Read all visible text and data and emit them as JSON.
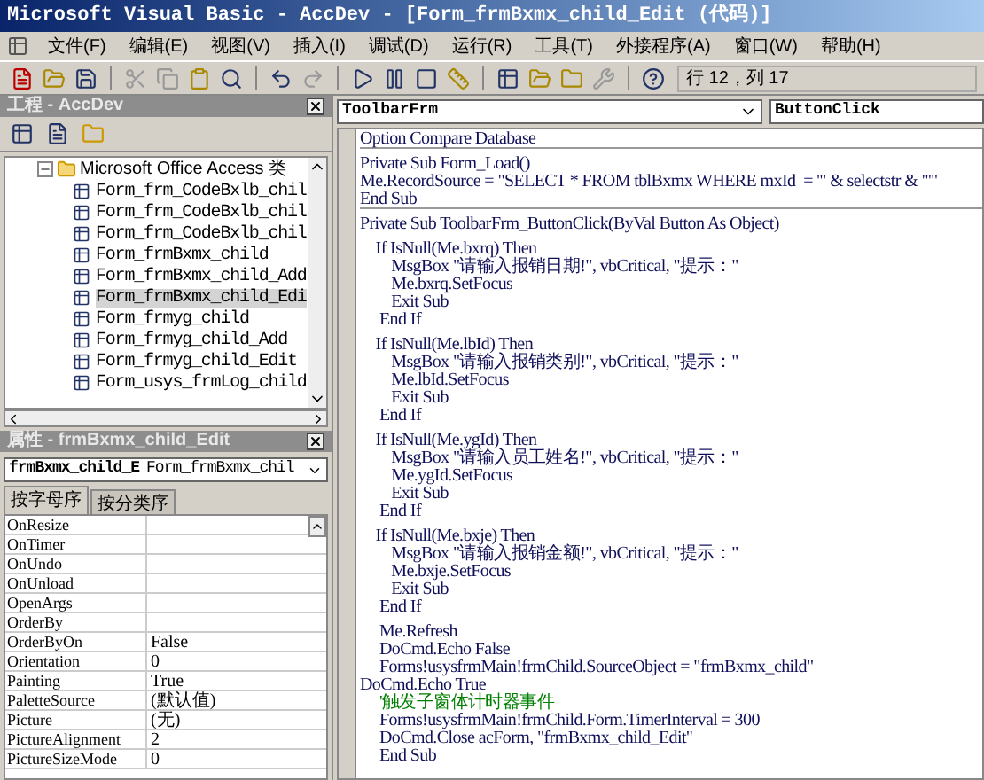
{
  "window": {
    "title": "Microsoft Visual Basic - AccDev - [Form_frmBxmx_child_Edit (代码)]"
  },
  "menu": [
    "文件(F)",
    "编辑(E)",
    "视图(V)",
    "插入(I)",
    "调试(D)",
    "运行(R)",
    "工具(T)",
    "外接程序(A)",
    "窗口(W)",
    "帮助(H)"
  ],
  "toolbar": {
    "position": "行 12，列 17"
  },
  "project": {
    "title": "工程 - AccDev",
    "tree": [
      {
        "label": "Microsoft Office Access 类",
        "expanded": true,
        "selected": false,
        "children": [
          {
            "label": "Form_frm_CodeBxlb_chil",
            "selected": false
          },
          {
            "label": "Form_frm_CodeBxlb_chil",
            "selected": false
          },
          {
            "label": "Form_frm_CodeBxlb_chil",
            "selected": false
          },
          {
            "label": "Form_frmBxmx_child",
            "selected": false
          },
          {
            "label": "Form_frmBxmx_child_Add",
            "selected": false
          },
          {
            "label": "Form_frmBxmx_child_Edi",
            "selected": true
          },
          {
            "label": "Form_frmyg_child",
            "selected": false
          },
          {
            "label": "Form_frmyg_child_Add",
            "selected": false
          },
          {
            "label": "Form_frmyg_child_Edit",
            "selected": false
          },
          {
            "label": "Form_usys_frmLog_child",
            "selected": false
          }
        ]
      }
    ]
  },
  "properties": {
    "title": "属性 - frmBxmx_child_Edit",
    "object": "frmBxmx_child_E",
    "object_type": "Form_frmBxmx_chil",
    "tabs": [
      {
        "label": "按字母序",
        "selected": true
      },
      {
        "label": "按分类序",
        "selected": false
      }
    ],
    "rows": [
      {
        "name": "OnResize",
        "value": ""
      },
      {
        "name": "OnTimer",
        "value": ""
      },
      {
        "name": "OnUndo",
        "value": ""
      },
      {
        "name": "OnUnload",
        "value": ""
      },
      {
        "name": "OpenArgs",
        "value": ""
      },
      {
        "name": "OrderBy",
        "value": ""
      },
      {
        "name": "OrderByOn",
        "value": "False"
      },
      {
        "name": "Orientation",
        "value": "0"
      },
      {
        "name": "Painting",
        "value": "True"
      },
      {
        "name": "PaletteSource",
        "value": "(默认值)"
      },
      {
        "name": "Picture",
        "value": "(无)"
      },
      {
        "name": "PictureAlignment",
        "value": "2"
      },
      {
        "name": "PictureSizeMode",
        "value": "0"
      }
    ]
  },
  "code": {
    "object": "ToolbarFrm",
    "procedure": "ButtonClick",
    "lines": [
      {
        "kind": "code",
        "text": "Option Compare Database",
        "divider_after": true
      },
      {
        "kind": "blank"
      },
      {
        "kind": "code",
        "text": "Private Sub Form_Load()"
      },
      {
        "kind": "code",
        "text": "Me.RecordSource = \"SELECT * FROM tblBxmx WHERE mxId  = '\" & selectstr & \"'\""
      },
      {
        "kind": "code",
        "text": "End Sub",
        "divider_after": true
      },
      {
        "kind": "blank"
      },
      {
        "kind": "code",
        "text": "Private Sub ToolbarFrm_ButtonClick(ByVal Button As Object)"
      },
      {
        "kind": "blank"
      },
      {
        "kind": "code",
        "text": "    If IsNull(Me.bxrq) Then"
      },
      {
        "kind": "code",
        "text": "        MsgBox \"请输入报销日期!\", vbCritical, \"提示：\""
      },
      {
        "kind": "code",
        "text": "        Me.bxrq.SetFocus"
      },
      {
        "kind": "code",
        "text": "        Exit Sub"
      },
      {
        "kind": "code",
        "text": "     End If"
      },
      {
        "kind": "blank"
      },
      {
        "kind": "code",
        "text": "    If IsNull(Me.lbId) Then"
      },
      {
        "kind": "code",
        "text": "        MsgBox \"请输入报销类别!\", vbCritical, \"提示：\""
      },
      {
        "kind": "code",
        "text": "        Me.lbId.SetFocus"
      },
      {
        "kind": "code",
        "text": "        Exit Sub"
      },
      {
        "kind": "code",
        "text": "     End If"
      },
      {
        "kind": "blank"
      },
      {
        "kind": "code",
        "text": "    If IsNull(Me.ygId) Then"
      },
      {
        "kind": "code",
        "text": "        MsgBox \"请输入员工姓名!\", vbCritical, \"提示：\""
      },
      {
        "kind": "code",
        "text": "        Me.ygId.SetFocus"
      },
      {
        "kind": "code",
        "text": "        Exit Sub"
      },
      {
        "kind": "code",
        "text": "     End If"
      },
      {
        "kind": "blank"
      },
      {
        "kind": "code",
        "text": "    If IsNull(Me.bxje) Then"
      },
      {
        "kind": "code",
        "text": "        MsgBox \"请输入报销金额!\", vbCritical, \"提示：\""
      },
      {
        "kind": "code",
        "text": "        Me.bxje.SetFocus"
      },
      {
        "kind": "code",
        "text": "        Exit Sub"
      },
      {
        "kind": "code",
        "text": "     End If"
      },
      {
        "kind": "blank"
      },
      {
        "kind": "code",
        "text": "     Me.Refresh"
      },
      {
        "kind": "code",
        "text": "     DoCmd.Echo False"
      },
      {
        "kind": "code",
        "text": "     Forms!usysfrmMain!frmChild.SourceObject = \"frmBxmx_child\""
      },
      {
        "kind": "code",
        "text": "DoCmd.Echo True"
      },
      {
        "kind": "comment",
        "text": "     '触发子窗体计时器事件"
      },
      {
        "kind": "code",
        "text": "     Forms!usysfrmMain!frmChild.Form.TimerInterval = 300"
      },
      {
        "kind": "code",
        "text": "     DoCmd.Close acForm, \"frmBxmx_child_Edit\""
      },
      {
        "kind": "code",
        "text": "     End Sub"
      }
    ]
  }
}
